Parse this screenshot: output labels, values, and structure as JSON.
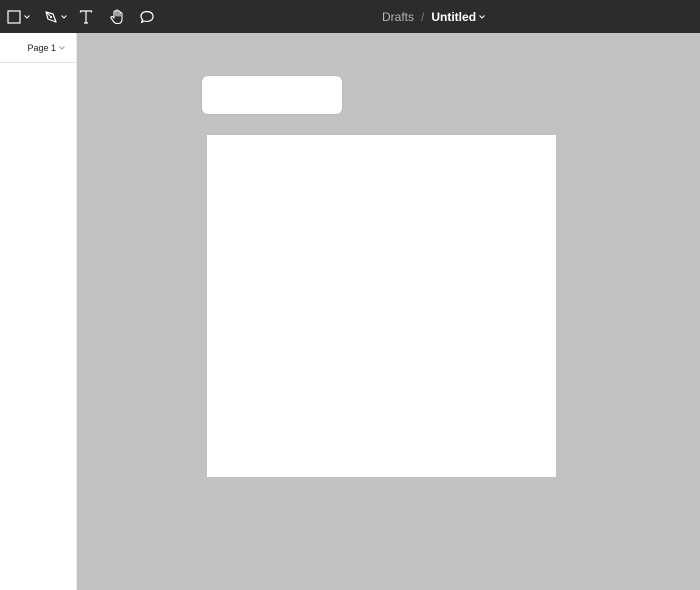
{
  "toolbar": {
    "tools": [
      {
        "name": "frame-tool",
        "icon": "square-icon"
      },
      {
        "name": "pen-tool",
        "icon": "pen-icon"
      },
      {
        "name": "text-tool",
        "icon": "text-icon"
      },
      {
        "name": "hand-tool",
        "icon": "hand-icon"
      },
      {
        "name": "comment-tool",
        "icon": "comment-icon"
      }
    ]
  },
  "breadcrumb": {
    "location": "Drafts",
    "separator": "/",
    "title": "Untitled"
  },
  "sidebar": {
    "page_label": "Page 1"
  },
  "colors": {
    "toolbar_bg": "#2c2c2c",
    "canvas_bg": "#c2c2c2",
    "frame_bg": "#ffffff"
  }
}
